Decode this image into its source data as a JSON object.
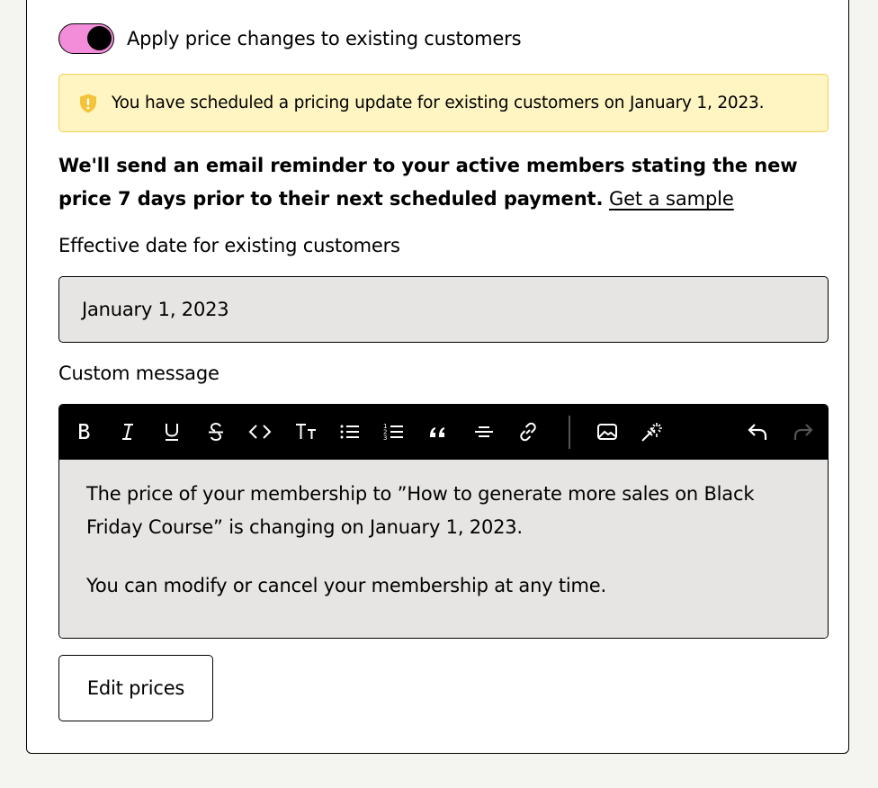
{
  "toggle": {
    "label": "Apply price changes to existing customers",
    "on": true,
    "color": "#f38cd9"
  },
  "notice": {
    "icon": "shield-warning-icon",
    "text": "You have scheduled a pricing update for existing customers on January 1, 2023.",
    "bg": "#fff5c2",
    "border": "#f2cf55"
  },
  "reminder": {
    "bold_text": "We'll send an email reminder to your active members stating the new price 7 days prior to their next scheduled payment.",
    "link_text": "Get a sample"
  },
  "effective_date": {
    "label": "Effective date for existing customers",
    "value": "January 1, 2023"
  },
  "custom_message": {
    "label": "Custom message",
    "toolbar": [
      "bold-icon",
      "italic-icon",
      "underline-icon",
      "strikethrough-icon",
      "code-icon",
      "text-size-icon",
      "bullet-list-icon",
      "numbered-list-icon",
      "quote-icon",
      "horizontal-rule-icon",
      "link-icon",
      "image-icon",
      "sparkle-icon",
      "undo-icon",
      "redo-icon"
    ],
    "paragraphs": [
      "The price of your membership to ”How to generate more sales on Black Friday Course” is changing on January 1, 2023.",
      "You can modify or cancel your membership at any time."
    ]
  },
  "edit_button": {
    "label": "Edit prices"
  }
}
